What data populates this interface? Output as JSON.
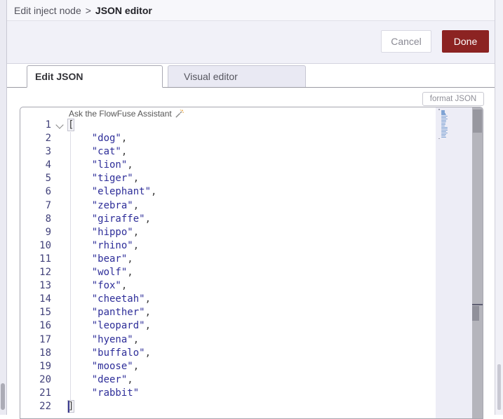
{
  "breadcrumb": {
    "parent": "Edit inject node",
    "separator": ">",
    "current": "JSON editor"
  },
  "actions": {
    "cancel_label": "Cancel",
    "done_label": "Done"
  },
  "tabs": [
    {
      "label": "Edit JSON",
      "active": true
    },
    {
      "label": "Visual editor",
      "active": false
    }
  ],
  "toolbar": {
    "format_button_label": "format JSON"
  },
  "editor": {
    "assistant_hint": "Ask the FlowFuse Assistant",
    "language": "json",
    "cursor_line": 22,
    "line_count": 22,
    "values": [
      "dog",
      "cat",
      "lion",
      "tiger",
      "elephant",
      "zebra",
      "giraffe",
      "hippo",
      "rhino",
      "bear",
      "wolf",
      "fox",
      "cheetah",
      "panther",
      "leopard",
      "hyena",
      "buffalo",
      "moose",
      "deer",
      "rabbit"
    ],
    "lines": [
      "[",
      "    \"dog\",",
      "    \"cat\",",
      "    \"lion\",",
      "    \"tiger\",",
      "    \"elephant\",",
      "    \"zebra\",",
      "    \"giraffe\",",
      "    \"hippo\",",
      "    \"rhino\",",
      "    \"bear\",",
      "    \"wolf\",",
      "    \"fox\",",
      "    \"cheetah\",",
      "    \"panther\",",
      "    \"leopard\",",
      "    \"hyena\",",
      "    \"buffalo\",",
      "    \"moose\",",
      "    \"deer\",",
      "    \"rabbit\"",
      "]"
    ]
  },
  "colors": {
    "done_button": "#8C2322",
    "code_string": "#2E2E99",
    "line_number": "#41417A",
    "minimap_mark": "#7FA3D4",
    "assistant_sparkle": "#E8A33D",
    "inactive_tab_bg": "#E9E9F3",
    "bar_bg": "#F1F1F8"
  }
}
